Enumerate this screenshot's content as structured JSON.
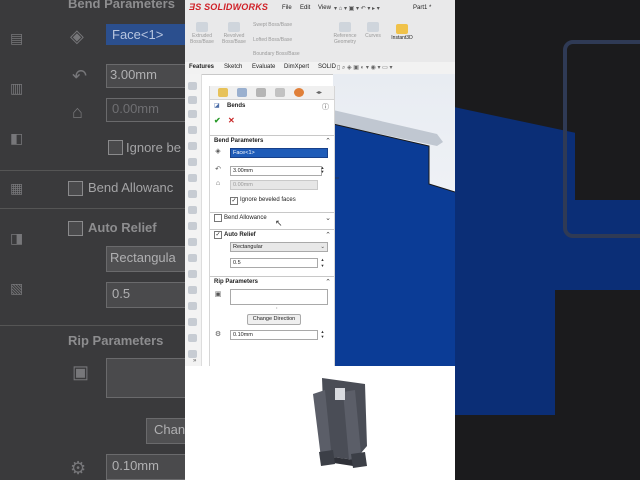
{
  "app": {
    "brand": "SOLIDWORKS",
    "menu": [
      "File",
      "Edit",
      "View"
    ],
    "doc_title": "Part1 *"
  },
  "toolbar": {
    "extruded": "Extruded Boss/Base",
    "revolved": "Revolved Boss/Base",
    "swept": "Swept Boss/Base",
    "lofted": "Lofted Boss/Base",
    "boundary": "Boundary Boss/Base",
    "reference": "Reference Geometry",
    "curves": "Curves",
    "instant3d": "Instant3D"
  },
  "tabs": [
    "Features",
    "Sketch",
    "Evaluate",
    "DimXpert",
    "SOLID"
  ],
  "pm": {
    "title": "Bends",
    "ok": "✔",
    "cancel": "✕",
    "bend_params": {
      "title": "Bend Parameters",
      "face": "Face<1>",
      "radius": "3.00mm",
      "thickness": "0.00mm",
      "ignore_beveled": "Ignore beveled faces",
      "ignore_checked": "✓"
    },
    "bend_allowance": {
      "title": "Bend Allowance"
    },
    "auto_relief": {
      "title": "Auto Relief",
      "checked": "✓",
      "type": "Rectangular",
      "ratio": "0.5"
    },
    "rip_params": {
      "title": "Rip Parameters",
      "change_direction": "Change Direction",
      "gap": "0.10mm"
    }
  },
  "background": {
    "bend_parameters": "Bend Parameters",
    "face": "Face<1>",
    "radius": "3.00mm",
    "thickness": "0.00mm",
    "ignore": "Ignore be",
    "bend_allowance": "Bend Allowanc",
    "auto_relief": "Auto Relief",
    "relief_type": "Rectangula",
    "ratio": "0.5",
    "rip_parameters": "Rip Parameters",
    "change": "Chan",
    "gap": "0.10mm"
  },
  "colors": {
    "accent": "#1f5cb8",
    "part_blue": "#0b3c96",
    "brand_red": "#d02027"
  }
}
